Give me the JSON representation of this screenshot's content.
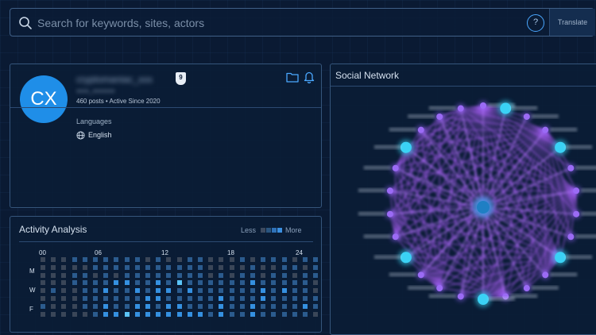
{
  "search": {
    "placeholder": "Search for keywords, sites, actors",
    "help_label": "?",
    "translate_label": "Translate"
  },
  "profile": {
    "initials": "CX",
    "username": "cryptomaniac_xxx",
    "subname": "xxxx_xxxxxxx",
    "badge": "9",
    "stats": "460 posts • Active Since 2020",
    "languages_label": "Languages",
    "language": "English"
  },
  "activity": {
    "title": "Activity Analysis",
    "legend_less": "Less",
    "legend_more": "More",
    "legend_colors": [
      "#3d4a5f",
      "#2a5580",
      "#2f72b8",
      "#3b8fe0",
      "#4db6f5"
    ],
    "hour_labels": [
      "00",
      "06",
      "12",
      "18",
      "24"
    ],
    "day_labels": [
      "M",
      "W",
      "F"
    ],
    "grid": [
      [
        0,
        0,
        0,
        1,
        1,
        1,
        1,
        1,
        1,
        1,
        0,
        1,
        0,
        0,
        1,
        1,
        0,
        0,
        0,
        1,
        0,
        1,
        1,
        1,
        0,
        1,
        1
      ],
      [
        0,
        0,
        0,
        0,
        0,
        1,
        1,
        1,
        1,
        1,
        1,
        1,
        1,
        1,
        1,
        1,
        0,
        0,
        0,
        0,
        1,
        0,
        0,
        1,
        1,
        0,
        1
      ],
      [
        0,
        0,
        0,
        1,
        1,
        0,
        1,
        0,
        1,
        1,
        1,
        1,
        1,
        1,
        1,
        1,
        0,
        1,
        0,
        1,
        1,
        0,
        1,
        1,
        0,
        1,
        1
      ],
      [
        0,
        0,
        0,
        1,
        1,
        1,
        1,
        2,
        2,
        1,
        1,
        2,
        1,
        3,
        1,
        1,
        1,
        1,
        1,
        1,
        2,
        1,
        1,
        1,
        1,
        1,
        0
      ],
      [
        0,
        1,
        0,
        0,
        1,
        1,
        2,
        1,
        1,
        2,
        1,
        2,
        2,
        1,
        2,
        1,
        1,
        1,
        1,
        1,
        1,
        2,
        1,
        2,
        1,
        1,
        0
      ],
      [
        0,
        0,
        0,
        0,
        1,
        1,
        1,
        1,
        1,
        1,
        2,
        2,
        1,
        1,
        1,
        1,
        1,
        2,
        1,
        1,
        1,
        2,
        1,
        1,
        1,
        1,
        1
      ],
      [
        1,
        0,
        0,
        0,
        1,
        1,
        2,
        1,
        1,
        2,
        2,
        1,
        2,
        2,
        1,
        1,
        1,
        2,
        1,
        1,
        2,
        1,
        1,
        1,
        1,
        2,
        1
      ],
      [
        0,
        0,
        0,
        0,
        0,
        1,
        2,
        2,
        3,
        2,
        2,
        2,
        2,
        2,
        2,
        2,
        1,
        2,
        1,
        1,
        2,
        1,
        1,
        1,
        1,
        1,
        0
      ]
    ]
  },
  "social": {
    "title": "Social Network"
  }
}
